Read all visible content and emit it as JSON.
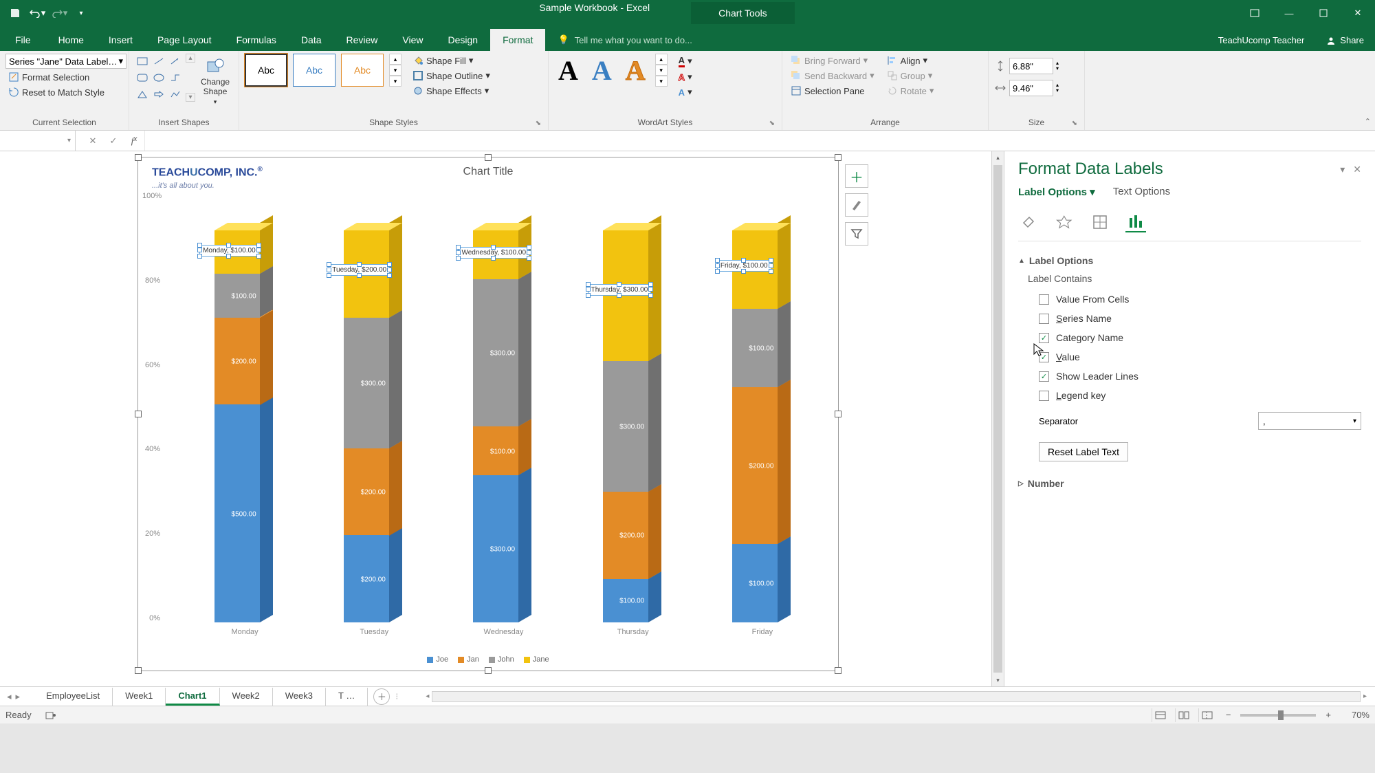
{
  "app": {
    "title": "Sample Workbook - Excel",
    "chart_tools": "Chart Tools",
    "account": "TeachUcomp Teacher",
    "share": "Share",
    "tell_me": "Tell me what you want to do..."
  },
  "tabs": {
    "file": "File",
    "home": "Home",
    "insert": "Insert",
    "page_layout": "Page Layout",
    "formulas": "Formulas",
    "data": "Data",
    "review": "Review",
    "view": "View",
    "design": "Design",
    "format": "Format"
  },
  "ribbon": {
    "current_selection": {
      "combo": "Series \"Jane\" Data Label…",
      "format_selection": "Format Selection",
      "reset": "Reset to Match Style",
      "label": "Current Selection"
    },
    "insert_shapes": {
      "change_shape": "Change\nShape",
      "label": "Insert Shapes"
    },
    "shape_styles": {
      "abc": "Abc",
      "fill": "Shape Fill",
      "outline": "Shape Outline",
      "effects": "Shape Effects",
      "label": "Shape Styles"
    },
    "wordart": {
      "label": "WordArt Styles"
    },
    "arrange": {
      "bring_forward": "Bring Forward",
      "send_backward": "Send Backward",
      "selection_pane": "Selection Pane",
      "align": "Align",
      "group": "Group",
      "rotate": "Rotate",
      "label": "Arrange"
    },
    "size": {
      "h": "6.88\"",
      "w": "9.46\"",
      "label": "Size"
    }
  },
  "chart": {
    "title": "Chart Title",
    "logo": "TEACHUCOMP, INC.",
    "logo_sub": "...it's all about you.",
    "y_ticks": [
      "100%",
      "80%",
      "60%",
      "40%",
      "20%",
      "0%"
    ],
    "categories": [
      "Monday",
      "Tuesday",
      "Wednesday",
      "Thursday",
      "Friday"
    ],
    "legend": [
      "Joe",
      "Jan",
      "John",
      "Jane"
    ],
    "data_labels": {
      "mon": "Monday, $100.00",
      "tue": "Tuesday, $200.00",
      "wed": "Wednesday, $100.00",
      "thu": "Thursday, $300.00",
      "fri": "Friday, $100.00"
    }
  },
  "chart_data": {
    "type": "bar",
    "subtype": "stacked-100-3d",
    "categories": [
      "Monday",
      "Tuesday",
      "Wednesday",
      "Thursday",
      "Friday"
    ],
    "series": [
      {
        "name": "Joe",
        "color": "#4a90d2",
        "values": [
          500,
          200,
          300,
          100,
          100
        ]
      },
      {
        "name": "Jan",
        "color": "#e38b26",
        "values": [
          200,
          200,
          100,
          200,
          200
        ]
      },
      {
        "name": "John",
        "color": "#9a9a9a",
        "values": [
          100,
          300,
          300,
          300,
          100
        ]
      },
      {
        "name": "Jane",
        "color": "#f2c30f",
        "values": [
          100,
          200,
          100,
          300,
          100
        ]
      }
    ],
    "value_prefix": "$",
    "value_suffix": ".00",
    "title": "Chart Title",
    "ylabel": "",
    "ylim_percent": [
      0,
      100
    ],
    "y_ticks_percent": [
      0,
      20,
      40,
      60,
      80,
      100
    ]
  },
  "format_pane": {
    "title": "Format Data Labels",
    "tab_label_options": "Label Options",
    "tab_text_options": "Text Options",
    "section_label_options": "Label Options",
    "label_contains": "Label Contains",
    "chk_value_from_cells": "Value From Cells",
    "chk_series_name": "Series Name",
    "chk_category_name": "Category Name",
    "chk_value": "Value",
    "chk_leader_lines": "Show Leader Lines",
    "chk_legend_key": "Legend key",
    "separator": "Separator",
    "separator_value": ",",
    "reset": "Reset Label Text",
    "section_number": "Number"
  },
  "sheets": {
    "tabs": [
      "EmployeeList",
      "Week1",
      "Chart1",
      "Week2",
      "Week3",
      "T …"
    ],
    "active": "Chart1"
  },
  "status": {
    "ready": "Ready",
    "zoom": "70%"
  }
}
